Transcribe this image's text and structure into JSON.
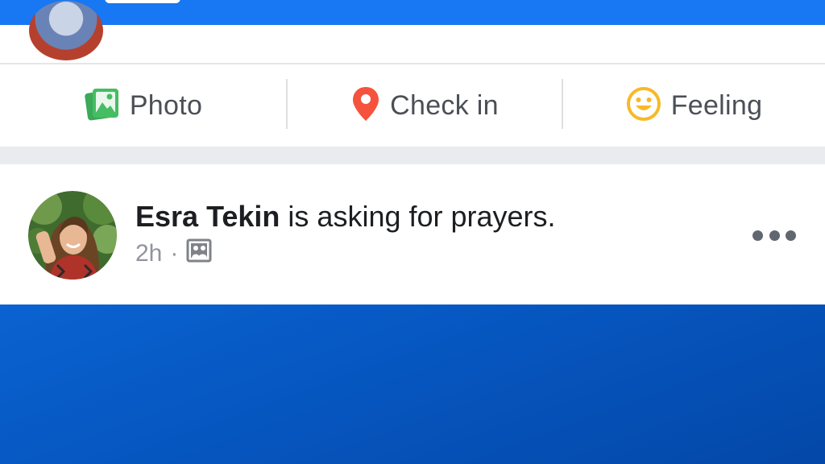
{
  "composer_actions": {
    "photo_label": "Photo",
    "checkin_label": "Check in",
    "feeling_label": "Feeling"
  },
  "post": {
    "author": "Esra Tekin",
    "activity": " is asking for prayers.",
    "time": "2h",
    "separator": "·",
    "privacy_icon": "photo-album-icon",
    "more_icon": "more-options-icon"
  },
  "colors": {
    "brand_blue": "#1877f2",
    "photo_green": "#45bd62",
    "checkin_red": "#f5533d",
    "feeling_yellow": "#f7b928",
    "content_blue": "#0656c0"
  }
}
